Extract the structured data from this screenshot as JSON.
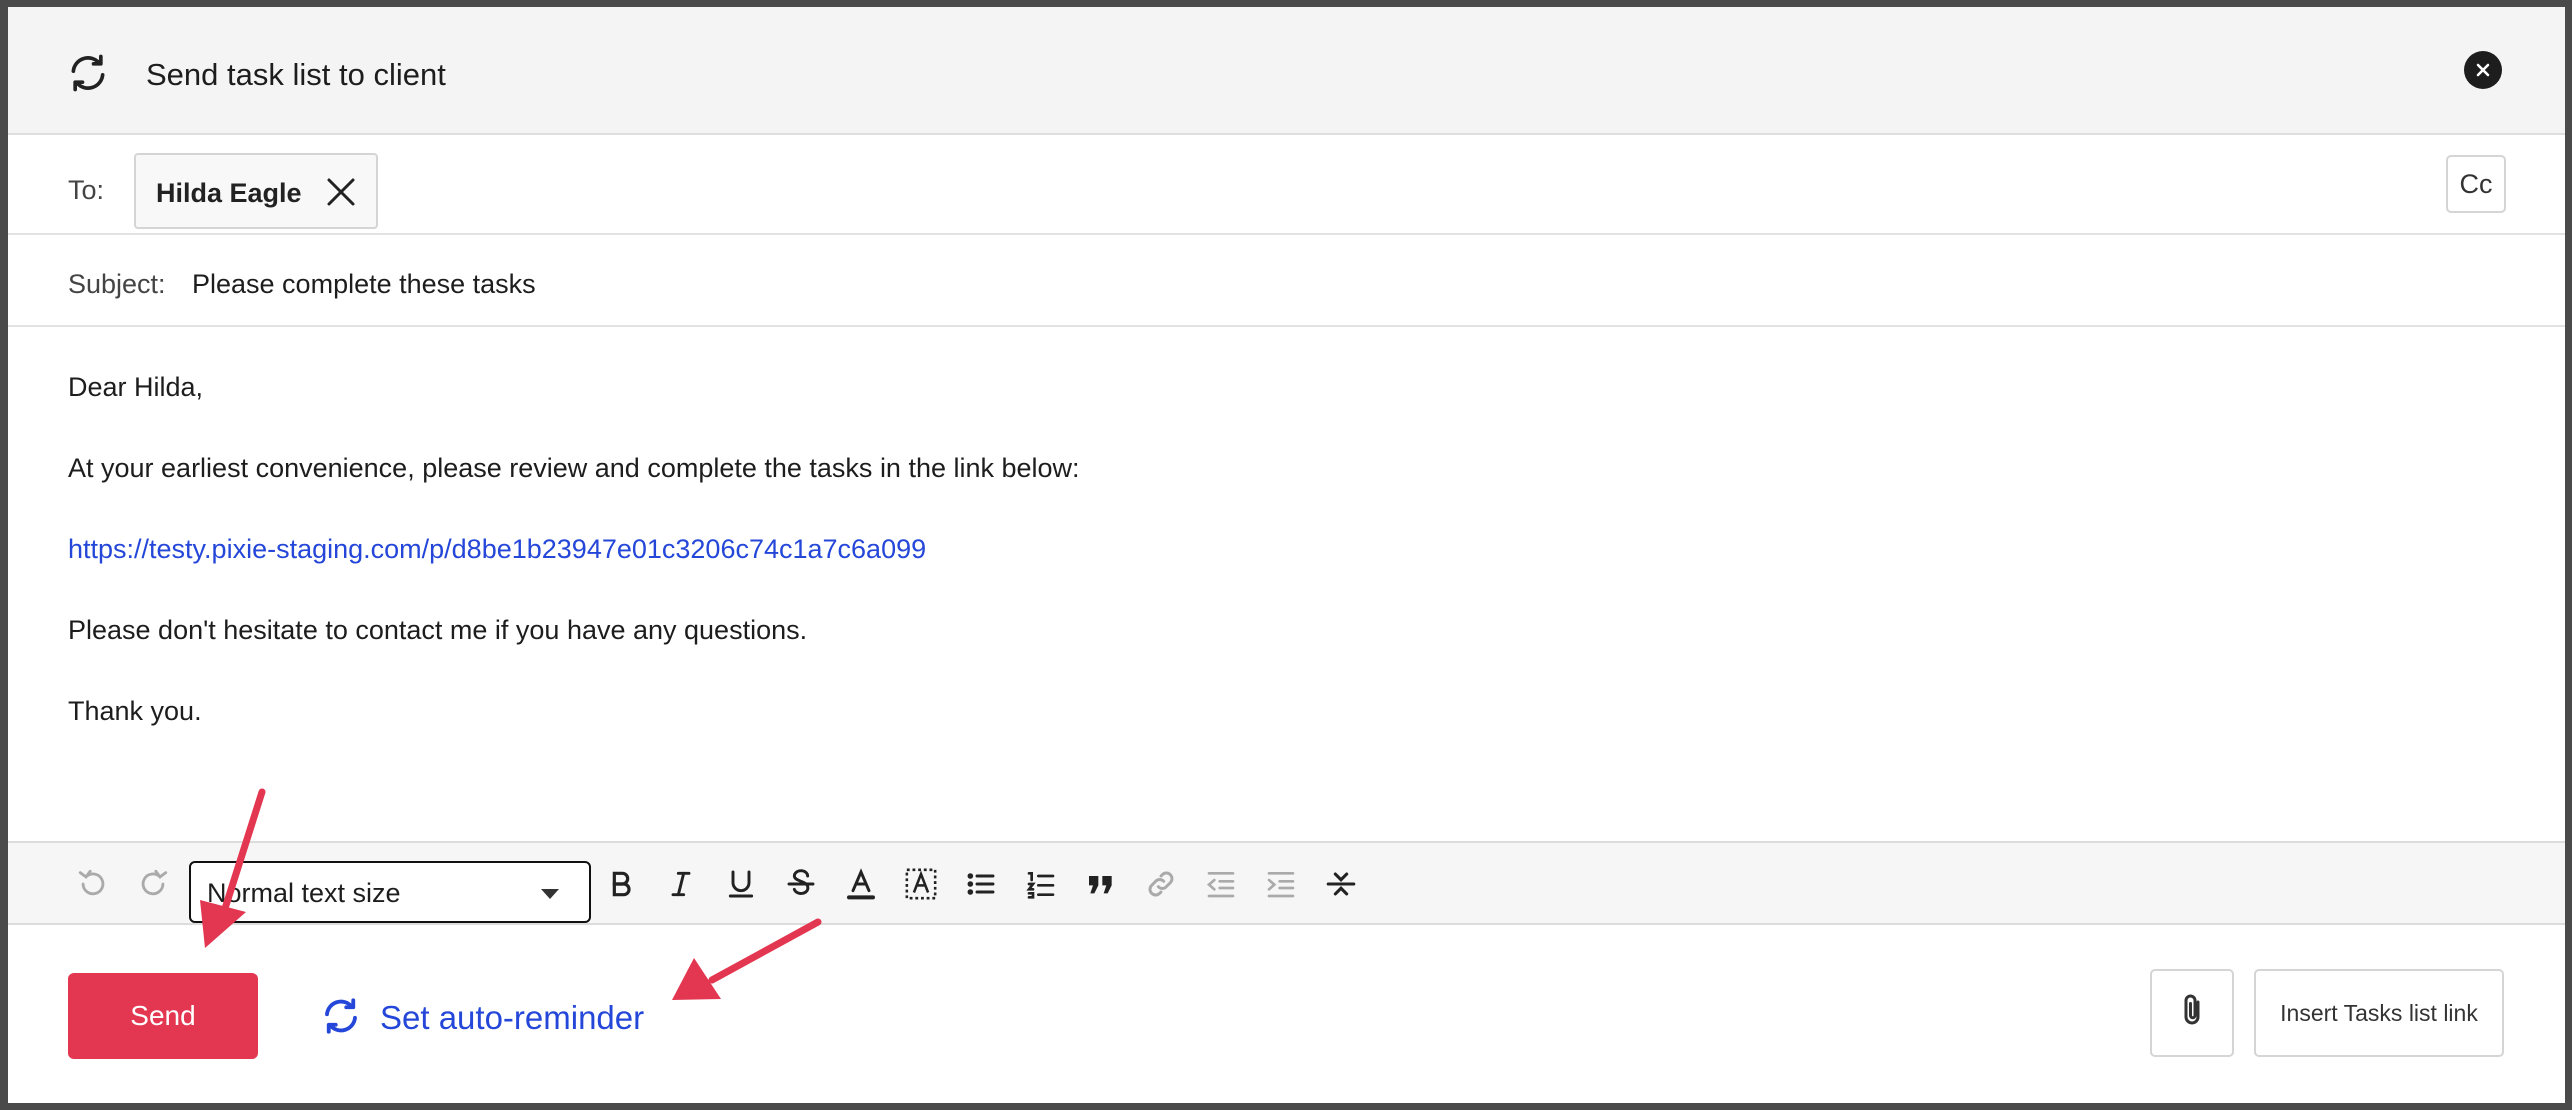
{
  "modal": {
    "title": "Send task list to client",
    "close_icon": "close-icon"
  },
  "to": {
    "label": "To:",
    "recipient": "Hilda Eagle",
    "cc_label": "Cc"
  },
  "subject": {
    "label": "Subject:",
    "value": "Please complete these tasks"
  },
  "body": {
    "greeting": "Dear Hilda,",
    "line1": "At your earliest convenience, please review and complete the tasks in the link below:",
    "link": "https://testy.pixie-staging.com/p/d8be1b23947e01c3206c74c1a7c6a099",
    "line2": "Please don't hesitate to contact me if you have any questions.",
    "closing": "Thank you."
  },
  "toolbar": {
    "text_size": "Normal text size",
    "icons": [
      "undo-icon",
      "redo-icon",
      "bold-icon",
      "italic-icon",
      "underline-icon",
      "strikethrough-icon",
      "text-color-icon",
      "highlight-icon",
      "bullet-list-icon",
      "numbered-list-icon",
      "quote-icon",
      "link-icon",
      "outdent-icon",
      "indent-icon",
      "horizontal-rule-icon"
    ]
  },
  "footer": {
    "send_label": "Send",
    "auto_reminder_label": "Set auto-reminder",
    "insert_tasks_label": "Insert Tasks list link"
  },
  "colors": {
    "accent_red": "#e33650",
    "link_blue": "#2447d9",
    "annotation_red": "#e33650"
  }
}
